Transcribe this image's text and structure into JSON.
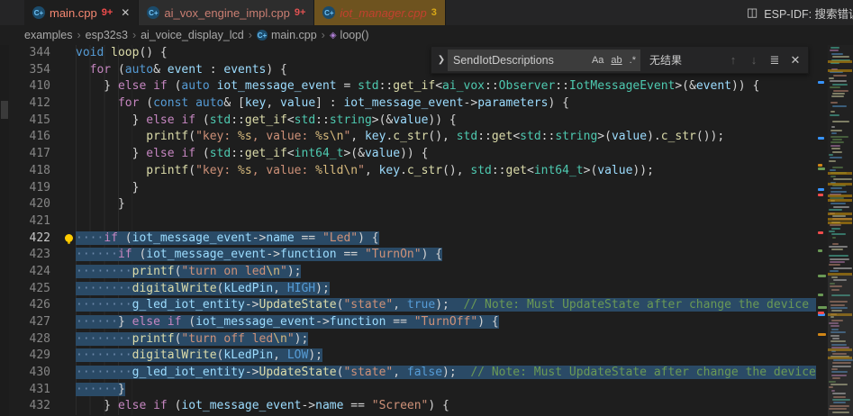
{
  "icons": {
    "cpp_label": "C+",
    "method_symbol": "◈",
    "split": "◫",
    "chevron": "❯",
    "close": "✕"
  },
  "tabs": [
    {
      "label": "main.cpp",
      "badge": "9+",
      "active": true,
      "closable": true,
      "label_color": "#f48771",
      "badge_color": "#f14c4c",
      "bg": "#1e1e1e",
      "italic": false
    },
    {
      "label": "ai_vox_engine_impl.cpp",
      "badge": "9+",
      "active": false,
      "closable": false,
      "label_color": "#c97e72",
      "badge_color": "#e05252",
      "bg": "#2d2d2d",
      "italic": false
    },
    {
      "label": "iot_manager.cpp",
      "badge": "3",
      "active": false,
      "closable": false,
      "label_color": "#c2412f",
      "badge_color": "#d9a917",
      "bg": "#6e531f",
      "italic": true
    }
  ],
  "actions": {
    "esp_label": "ESP-IDF: 搜索错误"
  },
  "breadcrumb": {
    "separator": "›",
    "items": [
      {
        "label": "examples"
      },
      {
        "label": "esp32s3"
      },
      {
        "label": "ai_voice_display_lcd"
      },
      {
        "label": "main.cpp",
        "icon": "cpp"
      },
      {
        "label": "loop()",
        "icon": "method"
      }
    ]
  },
  "find": {
    "query": "SendIotDescriptions",
    "result": "无结果",
    "toggles": [
      {
        "name": "match-case",
        "label": "Aa"
      },
      {
        "name": "whole-word",
        "label": "ab"
      },
      {
        "name": "regex",
        "label": ".*"
      }
    ],
    "buttons": [
      {
        "name": "previous-match",
        "label": "↑",
        "disabled": true
      },
      {
        "name": "next-match",
        "label": "↓",
        "disabled": true
      },
      {
        "name": "find-in-selection",
        "label": "≣",
        "disabled": false
      },
      {
        "name": "close-find",
        "label": "✕",
        "disabled": false
      }
    ]
  },
  "colors": {
    "selection": "#2a4a66",
    "search_mark": "#b8860b",
    "minimap_palette": [
      "#6a9955",
      "#569cd6",
      "#ce9178",
      "#4ec9b0",
      "#c586c0",
      "#d4d4d4",
      "#dcdcaa"
    ],
    "ruler_marks": [
      "#d18616",
      "#f14c4c",
      "#3794ff",
      "#6a9955"
    ]
  },
  "editor": {
    "lines": [
      {
        "n": 344,
        "t": [
          [
            "kw",
            "void"
          ],
          [
            "pun",
            " "
          ],
          [
            "fn",
            "loop"
          ],
          [
            "pun",
            "() {"
          ]
        ]
      },
      {
        "n": 354,
        "t": [
          [
            "pun",
            "  "
          ],
          [
            "ctrl",
            "for"
          ],
          [
            "pun",
            " ("
          ],
          [
            "kw",
            "auto"
          ],
          [
            "pun",
            "& "
          ],
          [
            "var",
            "event"
          ],
          [
            "pun",
            " : "
          ],
          [
            "var",
            "events"
          ],
          [
            "pun",
            ") {"
          ]
        ]
      },
      {
        "n": 410,
        "t": [
          [
            "pun",
            "    } "
          ],
          [
            "ctrl",
            "else"
          ],
          [
            "pun",
            " "
          ],
          [
            "ctrl",
            "if"
          ],
          [
            "pun",
            " ("
          ],
          [
            "kw",
            "auto"
          ],
          [
            "pun",
            " "
          ],
          [
            "var",
            "iot_message_event"
          ],
          [
            "pun",
            " = "
          ],
          [
            "type",
            "std"
          ],
          [
            "pun",
            "::"
          ],
          [
            "fn",
            "get_if"
          ],
          [
            "pun",
            "<"
          ],
          [
            "type",
            "ai_vox"
          ],
          [
            "pun",
            "::"
          ],
          [
            "type",
            "Observer"
          ],
          [
            "pun",
            "::"
          ],
          [
            "type",
            "IotMessageEvent"
          ],
          [
            "pun",
            ">(&"
          ],
          [
            "var",
            "event"
          ],
          [
            "pun",
            ")) {"
          ]
        ]
      },
      {
        "n": 412,
        "t": [
          [
            "pun",
            "      "
          ],
          [
            "ctrl",
            "for"
          ],
          [
            "pun",
            " ("
          ],
          [
            "kw",
            "const"
          ],
          [
            "pun",
            " "
          ],
          [
            "kw",
            "auto"
          ],
          [
            "pun",
            "& ["
          ],
          [
            "var",
            "key"
          ],
          [
            "pun",
            ", "
          ],
          [
            "var",
            "value"
          ],
          [
            "pun",
            "] : "
          ],
          [
            "var",
            "iot_message_event"
          ],
          [
            "pun",
            "->"
          ],
          [
            "var",
            "parameters"
          ],
          [
            "pun",
            ") {"
          ]
        ]
      },
      {
        "n": 415,
        "t": [
          [
            "pun",
            "        } "
          ],
          [
            "ctrl",
            "else"
          ],
          [
            "pun",
            " "
          ],
          [
            "ctrl",
            "if"
          ],
          [
            "pun",
            " ("
          ],
          [
            "type",
            "std"
          ],
          [
            "pun",
            "::"
          ],
          [
            "fn",
            "get_if"
          ],
          [
            "pun",
            "<"
          ],
          [
            "type",
            "std"
          ],
          [
            "pun",
            "::"
          ],
          [
            "type",
            "string"
          ],
          [
            "pun",
            ">(&"
          ],
          [
            "var",
            "value"
          ],
          [
            "pun",
            ")) {"
          ]
        ]
      },
      {
        "n": 416,
        "t": [
          [
            "pun",
            "          "
          ],
          [
            "fn",
            "printf"
          ],
          [
            "pun",
            "("
          ],
          [
            "str",
            "\"key: "
          ],
          [
            "esc",
            "%s"
          ],
          [
            "str",
            ", value: "
          ],
          [
            "esc",
            "%s"
          ],
          [
            "esc",
            "\\n"
          ],
          [
            "str",
            "\""
          ],
          [
            "pun",
            ", "
          ],
          [
            "var",
            "key"
          ],
          [
            "pun",
            "."
          ],
          [
            "fn",
            "c_str"
          ],
          [
            "pun",
            "(), "
          ],
          [
            "type",
            "std"
          ],
          [
            "pun",
            "::"
          ],
          [
            "fn",
            "get"
          ],
          [
            "pun",
            "<"
          ],
          [
            "type",
            "std"
          ],
          [
            "pun",
            "::"
          ],
          [
            "type",
            "string"
          ],
          [
            "pun",
            ">("
          ],
          [
            "var",
            "value"
          ],
          [
            "pun",
            ")."
          ],
          [
            "fn",
            "c_str"
          ],
          [
            "pun",
            "());"
          ]
        ]
      },
      {
        "n": 417,
        "t": [
          [
            "pun",
            "        } "
          ],
          [
            "ctrl",
            "else"
          ],
          [
            "pun",
            " "
          ],
          [
            "ctrl",
            "if"
          ],
          [
            "pun",
            " ("
          ],
          [
            "type",
            "std"
          ],
          [
            "pun",
            "::"
          ],
          [
            "fn",
            "get_if"
          ],
          [
            "pun",
            "<"
          ],
          [
            "type",
            "int64_t"
          ],
          [
            "pun",
            ">(&"
          ],
          [
            "var",
            "value"
          ],
          [
            "pun",
            ")) {"
          ]
        ]
      },
      {
        "n": 418,
        "t": [
          [
            "pun",
            "          "
          ],
          [
            "fn",
            "printf"
          ],
          [
            "pun",
            "("
          ],
          [
            "str",
            "\"key: "
          ],
          [
            "esc",
            "%s"
          ],
          [
            "str",
            ", value: "
          ],
          [
            "esc",
            "%lld"
          ],
          [
            "esc",
            "\\n"
          ],
          [
            "str",
            "\""
          ],
          [
            "pun",
            ", "
          ],
          [
            "var",
            "key"
          ],
          [
            "pun",
            "."
          ],
          [
            "fn",
            "c_str"
          ],
          [
            "pun",
            "(), "
          ],
          [
            "type",
            "std"
          ],
          [
            "pun",
            "::"
          ],
          [
            "fn",
            "get"
          ],
          [
            "pun",
            "<"
          ],
          [
            "type",
            "int64_t"
          ],
          [
            "pun",
            ">("
          ],
          [
            "var",
            "value"
          ],
          [
            "pun",
            "));"
          ]
        ]
      },
      {
        "n": 419,
        "t": [
          [
            "pun",
            "        }"
          ]
        ]
      },
      {
        "n": 420,
        "t": [
          [
            "pun",
            "      }"
          ]
        ]
      },
      {
        "n": 421,
        "t": []
      },
      {
        "n": 422,
        "sel": true,
        "cur": true,
        "bulb": true,
        "t": [
          [
            "ws",
            "····"
          ],
          [
            "ctrl",
            "if"
          ],
          [
            "pun",
            " ("
          ],
          [
            "var",
            "iot_message_event"
          ],
          [
            "pun",
            "->"
          ],
          [
            "var",
            "name"
          ],
          [
            "pun",
            " == "
          ],
          [
            "str",
            "\"Led\""
          ],
          [
            "pun",
            ") {"
          ]
        ]
      },
      {
        "n": 423,
        "sel": true,
        "t": [
          [
            "ws",
            "······"
          ],
          [
            "ctrl",
            "if"
          ],
          [
            "pun",
            " ("
          ],
          [
            "var",
            "iot_message_event"
          ],
          [
            "pun",
            "->"
          ],
          [
            "var",
            "function"
          ],
          [
            "pun",
            " == "
          ],
          [
            "str",
            "\"TurnOn\""
          ],
          [
            "pun",
            ") {"
          ]
        ]
      },
      {
        "n": 424,
        "sel": true,
        "t": [
          [
            "ws",
            "········"
          ],
          [
            "fn",
            "printf"
          ],
          [
            "pun",
            "("
          ],
          [
            "str",
            "\"turn on led"
          ],
          [
            "esc",
            "\\n"
          ],
          [
            "str",
            "\""
          ],
          [
            "pun",
            ");"
          ]
        ]
      },
      {
        "n": 425,
        "sel": true,
        "t": [
          [
            "ws",
            "········"
          ],
          [
            "fn",
            "digitalWrite"
          ],
          [
            "pun",
            "("
          ],
          [
            "var",
            "kLedPin"
          ],
          [
            "pun",
            ", "
          ],
          [
            "kw",
            "HIGH"
          ],
          [
            "pun",
            ");"
          ]
        ]
      },
      {
        "n": 426,
        "sel": true,
        "t": [
          [
            "ws",
            "········"
          ],
          [
            "var",
            "g_led_iot_entity"
          ],
          [
            "pun",
            "->"
          ],
          [
            "fn",
            "UpdateState"
          ],
          [
            "pun",
            "("
          ],
          [
            "str",
            "\"state\""
          ],
          [
            "pun",
            ", "
          ],
          [
            "kw",
            "true"
          ],
          [
            "pun",
            ");  "
          ],
          [
            "cmt",
            "// Note: Must UpdateState after change the device state"
          ]
        ]
      },
      {
        "n": 427,
        "sel": true,
        "t": [
          [
            "ws",
            "······"
          ],
          [
            "pun",
            "} "
          ],
          [
            "ctrl",
            "else"
          ],
          [
            "pun",
            " "
          ],
          [
            "ctrl",
            "if"
          ],
          [
            "pun",
            " ("
          ],
          [
            "var",
            "iot_message_event"
          ],
          [
            "pun",
            "->"
          ],
          [
            "var",
            "function"
          ],
          [
            "pun",
            " == "
          ],
          [
            "str",
            "\"TurnOff\""
          ],
          [
            "pun",
            ") {"
          ]
        ]
      },
      {
        "n": 428,
        "sel": true,
        "t": [
          [
            "ws",
            "········"
          ],
          [
            "fn",
            "printf"
          ],
          [
            "pun",
            "("
          ],
          [
            "str",
            "\"turn off led"
          ],
          [
            "esc",
            "\\n"
          ],
          [
            "str",
            "\""
          ],
          [
            "pun",
            ");"
          ]
        ]
      },
      {
        "n": 429,
        "sel": true,
        "t": [
          [
            "ws",
            "········"
          ],
          [
            "fn",
            "digitalWrite"
          ],
          [
            "pun",
            "("
          ],
          [
            "var",
            "kLedPin"
          ],
          [
            "pun",
            ", "
          ],
          [
            "kw",
            "LOW"
          ],
          [
            "pun",
            ");"
          ]
        ]
      },
      {
        "n": 430,
        "sel": true,
        "t": [
          [
            "ws",
            "········"
          ],
          [
            "var",
            "g_led_iot_entity"
          ],
          [
            "pun",
            "->"
          ],
          [
            "fn",
            "UpdateState"
          ],
          [
            "pun",
            "("
          ],
          [
            "str",
            "\"state\""
          ],
          [
            "pun",
            ", "
          ],
          [
            "kw",
            "false"
          ],
          [
            "pun",
            ");  "
          ],
          [
            "cmt",
            "// Note: Must UpdateState after change the device state"
          ]
        ]
      },
      {
        "n": 431,
        "sel": true,
        "t": [
          [
            "ws",
            "······"
          ],
          [
            "pun",
            "}"
          ]
        ]
      },
      {
        "n": 432,
        "t": [
          [
            "pun",
            "    } "
          ],
          [
            "ctrl",
            "else"
          ],
          [
            "pun",
            " "
          ],
          [
            "ctrl",
            "if"
          ],
          [
            "pun",
            " ("
          ],
          [
            "var",
            "iot_message_event"
          ],
          [
            "pun",
            "->"
          ],
          [
            "var",
            "name"
          ],
          [
            "pun",
            " == "
          ],
          [
            "str",
            "\"Screen\""
          ],
          [
            "pun",
            ") {"
          ]
        ]
      }
    ]
  }
}
